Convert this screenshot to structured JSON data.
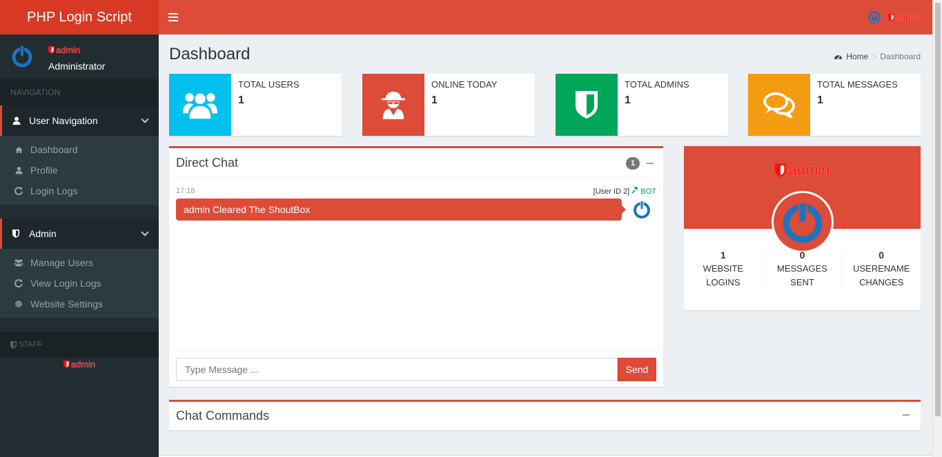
{
  "app": {
    "logo": "PHP Login Script"
  },
  "header": {
    "username": "admin"
  },
  "sidebar": {
    "user": {
      "name": "admin",
      "role": "Administrator"
    },
    "navigation_label": "NAVIGATION",
    "user_nav": {
      "label": "User Navigation",
      "items": [
        {
          "label": "Dashboard",
          "icon": "dashboard-icon"
        },
        {
          "label": "Profile",
          "icon": "user-icon"
        },
        {
          "label": "Login Logs",
          "icon": "refresh-icon"
        }
      ]
    },
    "admin_nav": {
      "label": "Admin",
      "items": [
        {
          "label": "Manage Users",
          "icon": "users-icon"
        },
        {
          "label": "View Login Logs",
          "icon": "refresh-icon"
        },
        {
          "label": "Website Settings",
          "icon": "gear-icon"
        }
      ]
    },
    "staff_label": "STAFF",
    "staff_members": [
      "admin"
    ]
  },
  "page": {
    "title": "Dashboard",
    "breadcrumb": [
      "Home",
      "Dashboard"
    ]
  },
  "stats_boxes": [
    {
      "label": "TOTAL USERS",
      "value": "1",
      "color": "#00c0ef",
      "icon": "users-icon"
    },
    {
      "label": "ONLINE TODAY",
      "value": "1",
      "color": "#dd4b39",
      "icon": "spy-icon"
    },
    {
      "label": "TOTAL ADMINS",
      "value": "1",
      "color": "#00a65a",
      "icon": "shield-icon"
    },
    {
      "label": "TOTAL MESSAGES",
      "value": "1",
      "color": "#f39c12",
      "icon": "chat-icon"
    }
  ],
  "chat": {
    "title": "Direct Chat",
    "badge": "1",
    "messages": [
      {
        "time": "17:18",
        "user": "[User ID 2]",
        "tag": "BOT",
        "text": "admin Cleared The ShoutBox"
      }
    ],
    "input_placeholder": "Type Message ...",
    "send_label": "Send"
  },
  "profile": {
    "name": "admin",
    "stats": [
      {
        "value": "1",
        "label": "WEBSITE LOGINS"
      },
      {
        "value": "0",
        "label": "MESSAGES SENT"
      },
      {
        "value": "0",
        "label": "USERENAME CHANGES"
      }
    ]
  },
  "commands": {
    "title": "Chat Commands"
  },
  "colors": {
    "primary": "#dd4b39",
    "primary_dark": "#d73925",
    "sidebar": "#222d32",
    "admin_red": "#ff1010",
    "power_blue": "#1e73be"
  }
}
